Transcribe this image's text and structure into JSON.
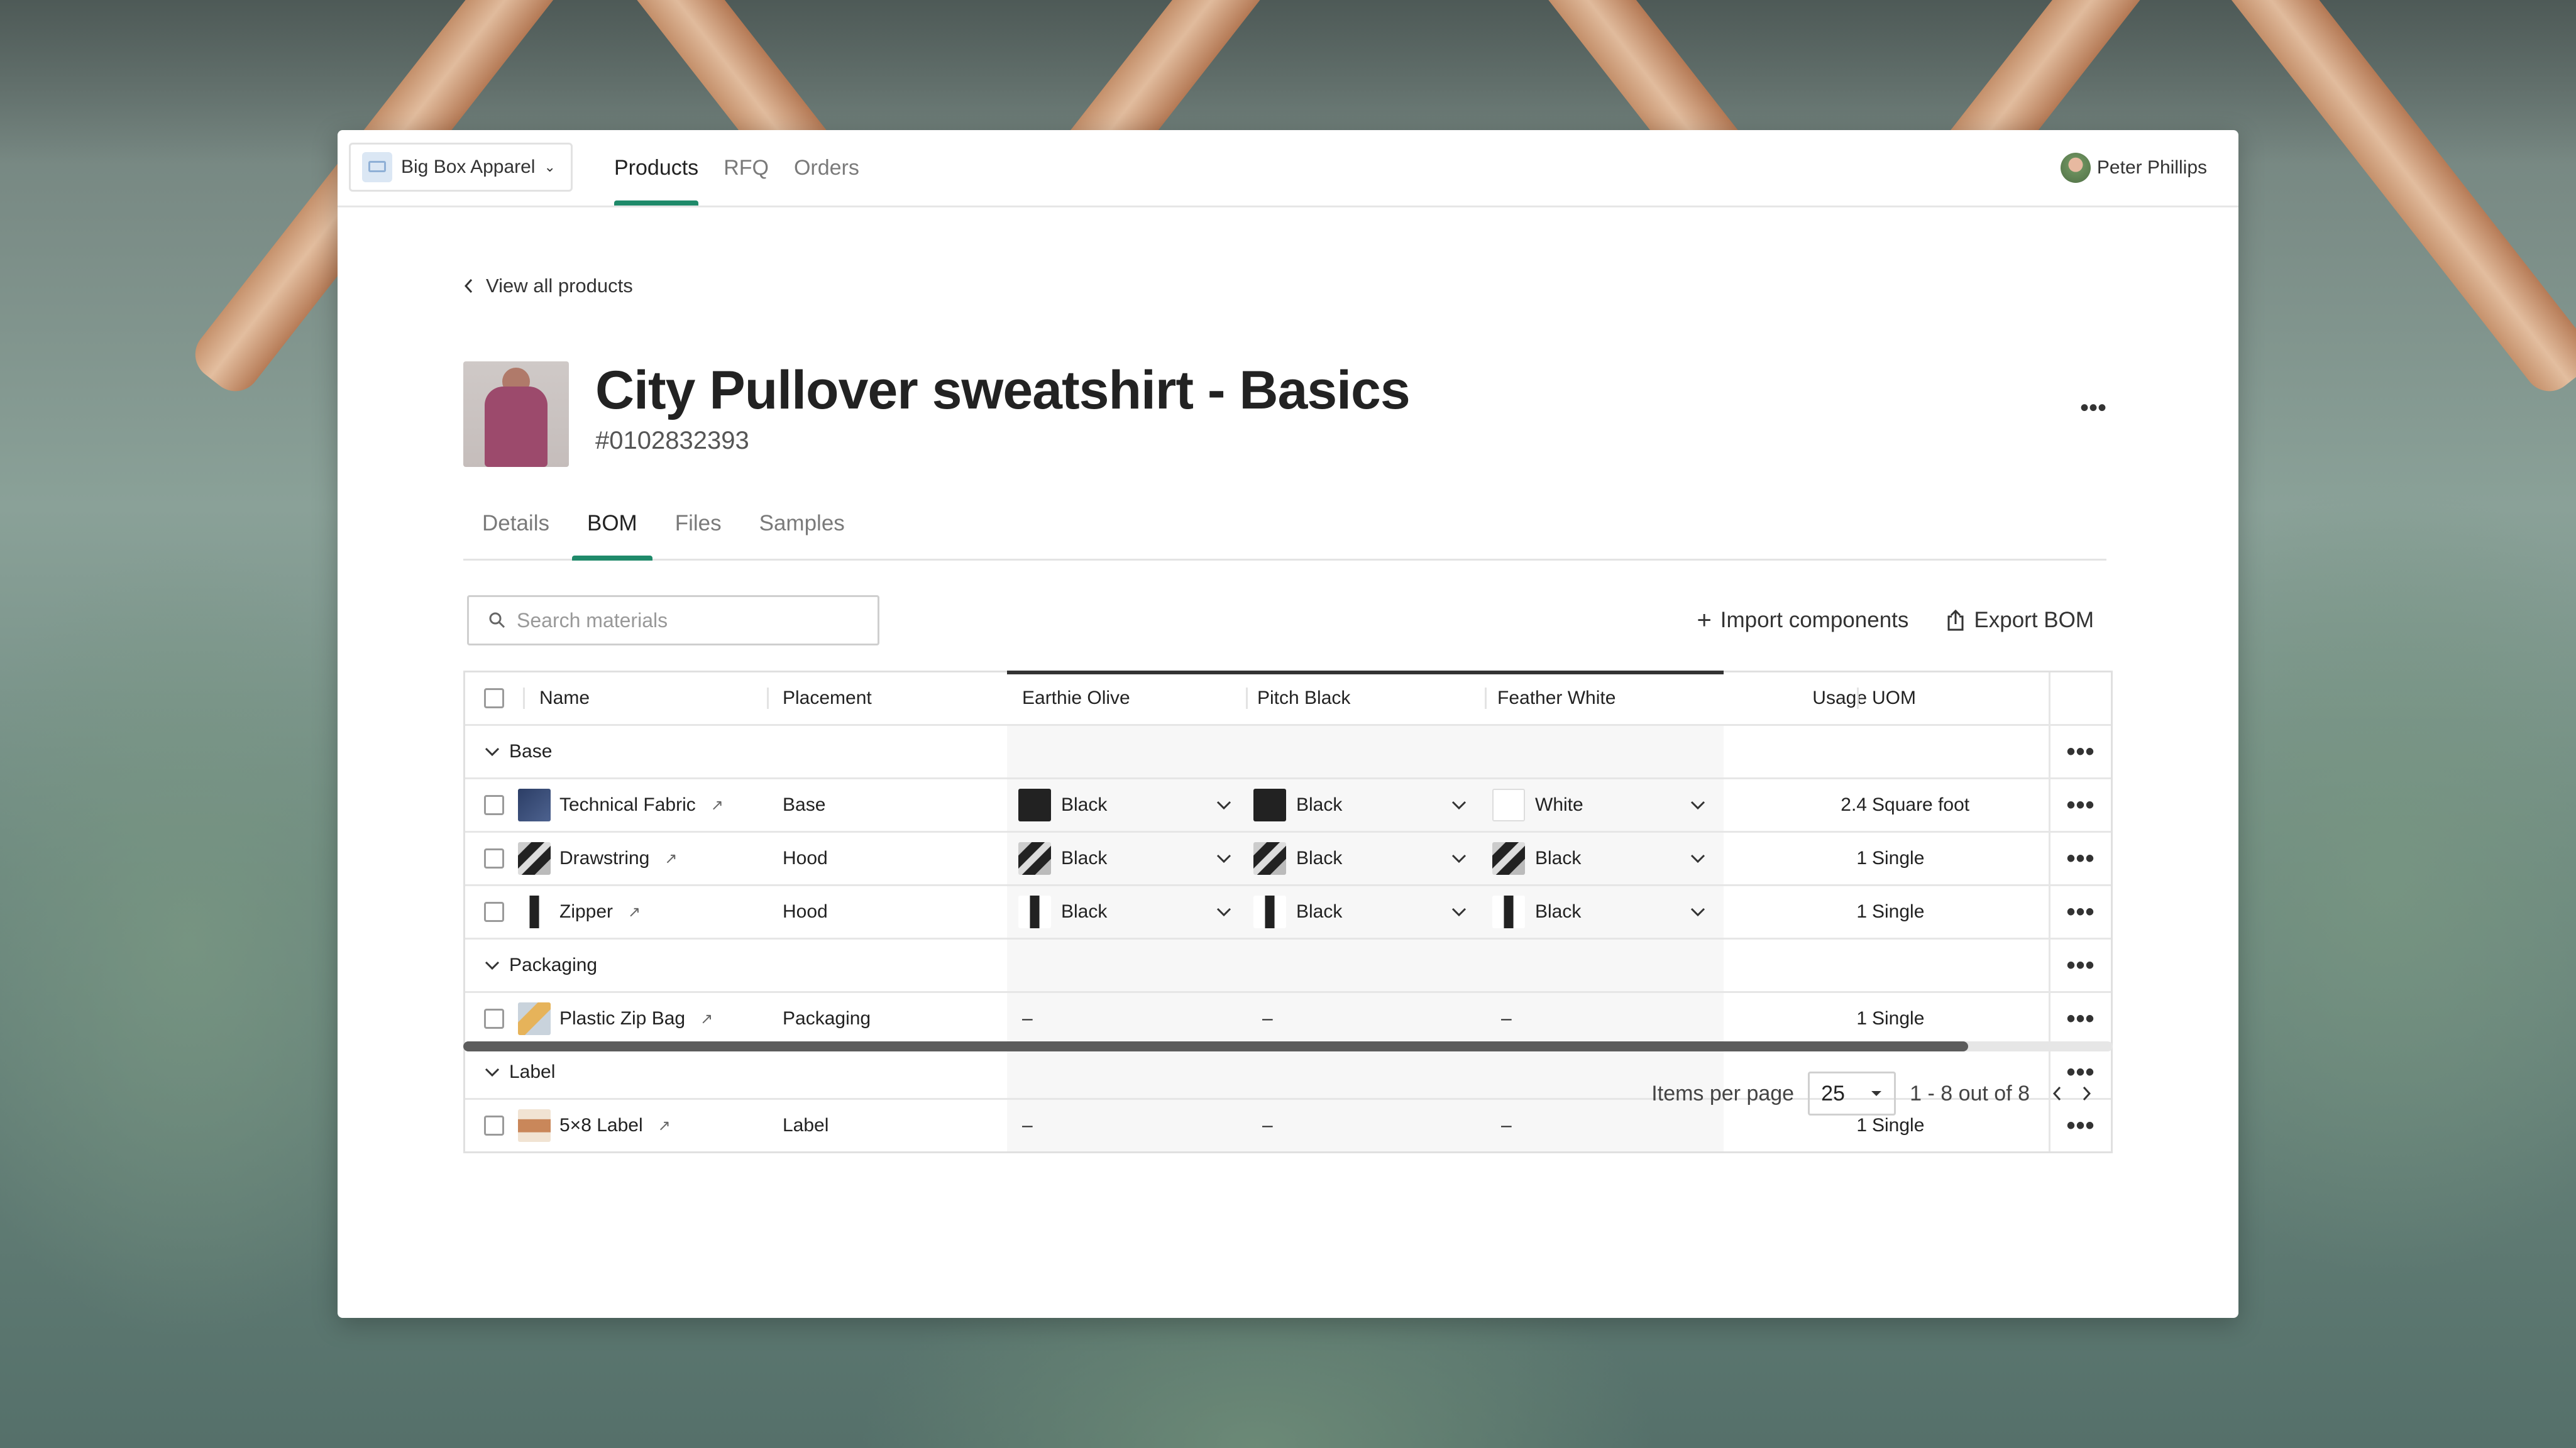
{
  "brand": {
    "name": "Big Box Apparel"
  },
  "nav": {
    "tabs": [
      "Products",
      "RFQ",
      "Orders"
    ],
    "active": "Products"
  },
  "user": {
    "name": "Peter Phillips"
  },
  "back_label": "View all products",
  "product": {
    "title": "City Pullover sweatshirt - Basics",
    "sku": "#0102832393"
  },
  "tabs": {
    "items": [
      "Details",
      "BOM",
      "Files",
      "Samples"
    ],
    "active": "BOM"
  },
  "search": {
    "placeholder": "Search materials"
  },
  "actions": {
    "import": "Import components",
    "export": "Export BOM"
  },
  "table": {
    "columns": {
      "name": "Name",
      "placement": "Placement",
      "c1": "Earthie Olive",
      "c2": "Pitch Black",
      "c3": "Feather White",
      "usage": "Usage",
      "uom": "UOM"
    },
    "groups": {
      "base": "Base",
      "packaging": "Packaging",
      "label": "Label"
    },
    "rows": {
      "fabric": {
        "name": "Technical Fabric",
        "placement": "Base",
        "c1": "Black",
        "c2": "Black",
        "c3": "White",
        "usage": "2.4",
        "uom": "Square foot"
      },
      "drawstring": {
        "name": "Drawstring",
        "placement": "Hood",
        "c1": "Black",
        "c2": "Black",
        "c3": "Black",
        "usage": "1",
        "uom": "Single"
      },
      "zipper": {
        "name": "Zipper",
        "placement": "Hood",
        "c1": "Black",
        "c2": "Black",
        "c3": "Black",
        "usage": "1",
        "uom": "Single"
      },
      "bag": {
        "name": "Plastic Zip Bag",
        "placement": "Packaging",
        "c1": "–",
        "c2": "–",
        "c3": "–",
        "usage": "1",
        "uom": "Single"
      },
      "label": {
        "name": "5×8 Label",
        "placement": "Label",
        "c1": "–",
        "c2": "–",
        "c3": "–",
        "usage": "1",
        "uom": "Single"
      }
    }
  },
  "pagination": {
    "items_per_page_label": "Items per page",
    "per_page": "25",
    "range": "1 - 8 out of 8"
  },
  "colors": {
    "accent": "#1f8a6a",
    "black_swatch": "#222222",
    "white_swatch": "#ffffff"
  },
  "icons": [
    "chevron-left-icon",
    "chevron-down-icon",
    "search-icon",
    "plus-icon",
    "export-icon",
    "more-icon",
    "external-link-icon",
    "chevron-right-icon",
    "caret-down-icon"
  ]
}
